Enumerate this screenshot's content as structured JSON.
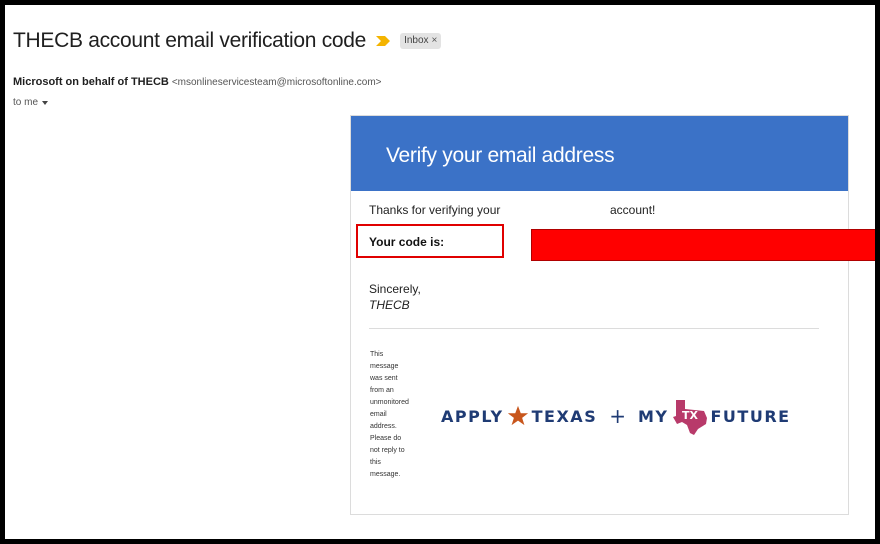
{
  "email": {
    "subject": "THECB account email verification code",
    "label": "Inbox",
    "label_remove": "×",
    "sender_name": "Microsoft on behalf of THECB",
    "sender_email": "<msonlineservicesteam@microsoftonline.com>",
    "recipient": "to me"
  },
  "message": {
    "header_title": "Verify your email address",
    "thanks_text": "Thanks for verifying your",
    "thanks_tail": "account!",
    "code_label": "Your code is:",
    "closing": "Sincerely,",
    "signature": "THECB",
    "disclaimer": "This message was sent from an unmonitored email address. Please do not reply to this message."
  },
  "logo": {
    "apply": "APPLY",
    "texas": "TEXAS",
    "plus": "+",
    "my": "MY",
    "tx": "TX",
    "future": "FUTURE"
  },
  "colors": {
    "header_blue": "#3b72c7",
    "redaction": "#ff0000",
    "logo_navy": "#1f3b74",
    "star_orange": "#c8561c",
    "texas_pink": "#b83a6a"
  }
}
